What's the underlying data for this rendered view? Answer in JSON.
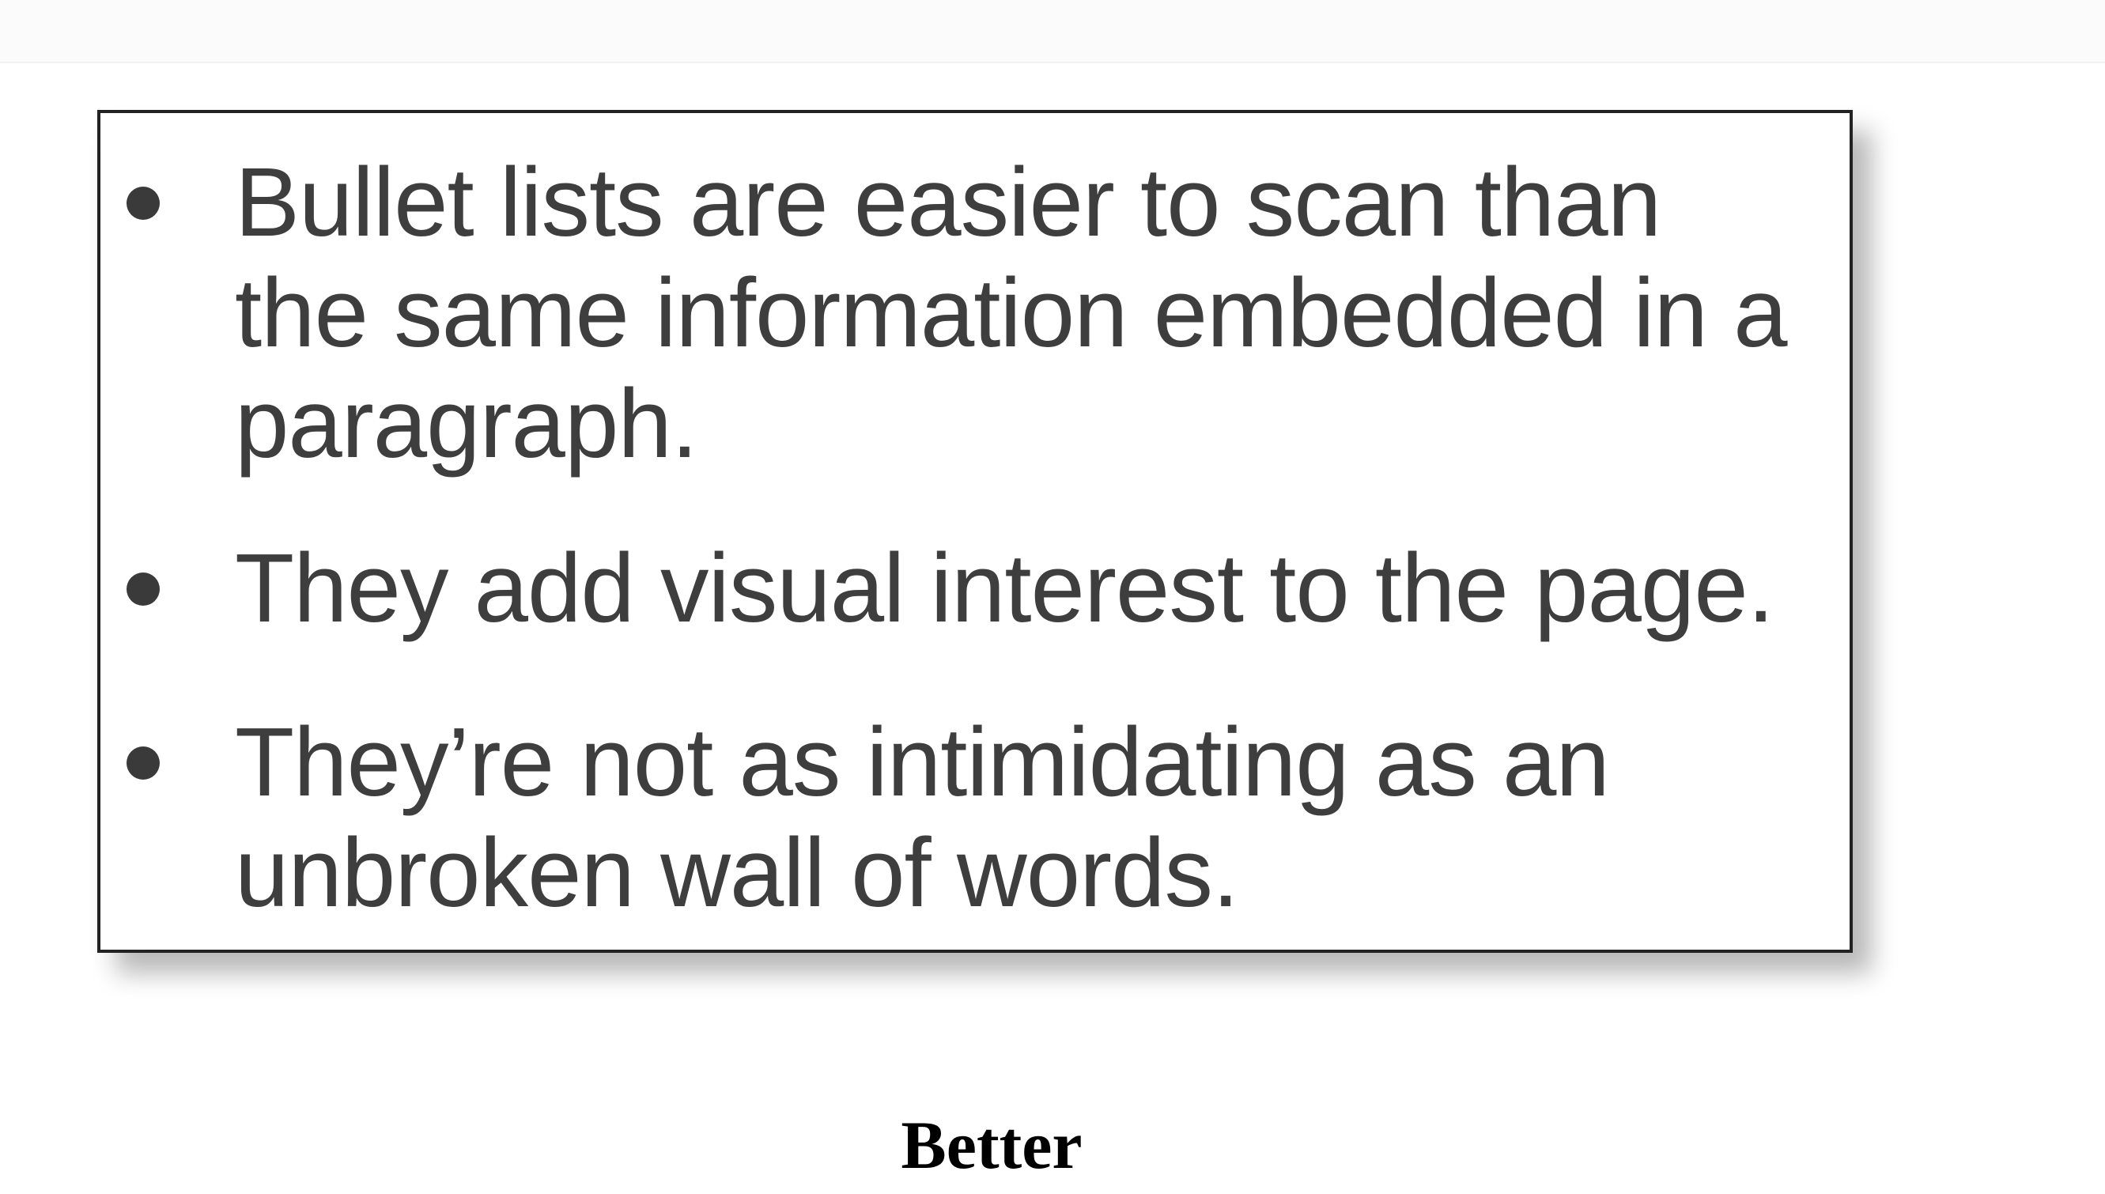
{
  "bullets": {
    "items": [
      {
        "text": "Bullet lists are easier to scan than\nthe same information embedded in a\nparagraph."
      },
      {
        "text": "They add visual interest to the page."
      },
      {
        "text": "They’re not as intimidating as an\nunbroken wall of words."
      }
    ]
  },
  "caption": {
    "text": "Better"
  }
}
